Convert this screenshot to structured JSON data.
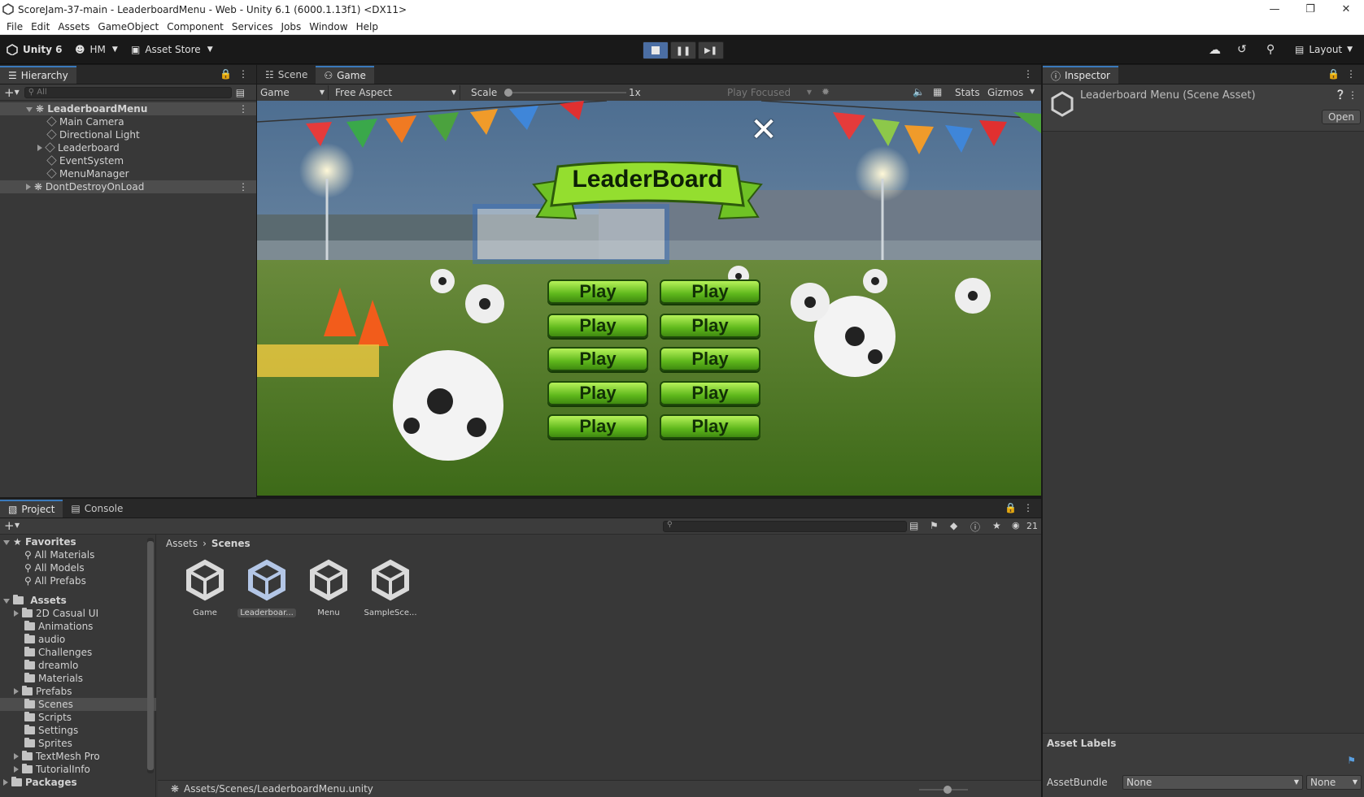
{
  "window": {
    "title": "ScoreJam-37-main - LeaderboardMenu - Web - Unity 6.1 (6000.1.13f1) <DX11>"
  },
  "menu": [
    "File",
    "Edit",
    "Assets",
    "GameObject",
    "Component",
    "Services",
    "Jobs",
    "Window",
    "Help"
  ],
  "toolbar": {
    "unity": "Unity 6",
    "account": "HM",
    "asset_store": "Asset Store",
    "layout": "Layout"
  },
  "hierarchy": {
    "tab": "Hierarchy",
    "search_placeholder": "All",
    "items": [
      {
        "label": "LeaderboardMenu"
      },
      {
        "label": "Main Camera"
      },
      {
        "label": "Directional Light"
      },
      {
        "label": "Leaderboard"
      },
      {
        "label": "EventSystem"
      },
      {
        "label": "MenuManager"
      },
      {
        "label": "DontDestroyOnLoad"
      }
    ]
  },
  "scene_tabs": {
    "scene": "Scene",
    "game": "Game"
  },
  "game_toolbar": {
    "display": "Game",
    "aspect": "Free Aspect",
    "scale_label": "Scale",
    "scale_value": "1x",
    "play_mode": "Play Focused",
    "stats": "Stats",
    "gizmos": "Gizmos"
  },
  "game": {
    "title": "LeaderBoard",
    "play_label": "Play"
  },
  "inspector": {
    "tab": "Inspector",
    "title": "Leaderboard Menu (Scene Asset)",
    "open": "Open",
    "asset_labels": "Asset Labels",
    "asset_bundle_label": "AssetBundle",
    "asset_bundle_value": "None",
    "variant_value": "None"
  },
  "project": {
    "tab": "Project",
    "console_tab": "Console",
    "count": "21",
    "favorites": {
      "label": "Favorites",
      "items": [
        "All Materials",
        "All Models",
        "All Prefabs"
      ]
    },
    "assets": {
      "label": "Assets",
      "items": [
        "2D Casual UI",
        "Animations",
        "audio",
        "Challenges",
        "dreamlo",
        "Materials",
        "Prefabs",
        "Scenes",
        "Scripts",
        "Settings",
        "Sprites",
        "TextMesh Pro",
        "TutorialInfo"
      ]
    },
    "packages": "Packages",
    "breadcrumb": [
      "Assets",
      "Scenes"
    ],
    "files": [
      "Game",
      "Leaderboar...",
      "Menu",
      "SampleSce..."
    ],
    "path": "Assets/Scenes/LeaderboardMenu.unity"
  }
}
